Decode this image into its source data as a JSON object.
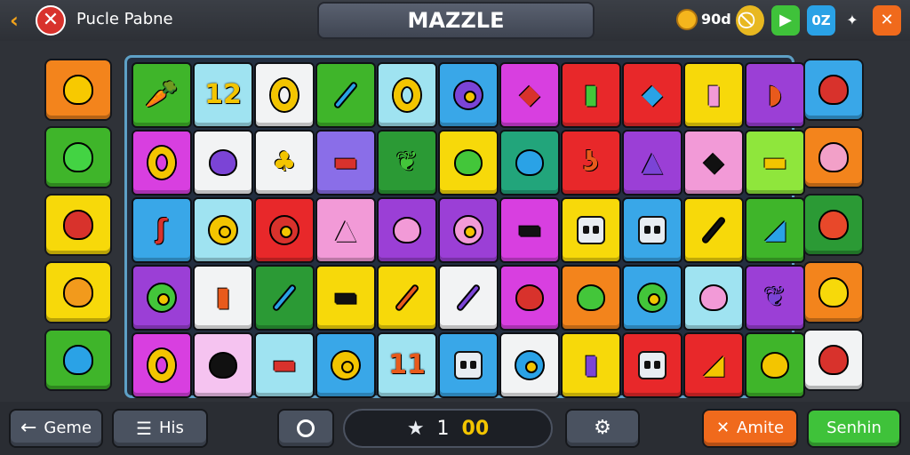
{
  "header": {
    "back_icon": "chevron-left-icon",
    "close_icon": "x-circle-icon",
    "puzzle_name": "Pucle Pabne",
    "title": "MAZZLE",
    "coin_icon": "coin-icon",
    "coin_count": "90d",
    "buttons": [
      {
        "name": "no-ads-icon",
        "label": "⃠"
      },
      {
        "name": "play-icon",
        "label": "▶"
      },
      {
        "name": "oz-badge",
        "label": "0Z"
      },
      {
        "name": "sparkle-icon",
        "label": "✦"
      },
      {
        "name": "close-icon",
        "label": "✕"
      }
    ]
  },
  "colors": {
    "orange": "#f3841c",
    "green": "#3fb52a",
    "yellow": "#f7d90a",
    "blue": "#39a7e8",
    "white": "#f2f3f4",
    "cyan": "#9fe3f1",
    "red": "#e8282a",
    "purple": "#9b3fd6",
    "magenta": "#d83fe0",
    "pink": "#f29ad7",
    "lime": "#8fe63c",
    "teal": "#22a57b",
    "darkgreen": "#2b9a35",
    "violet": "#8a6ee8",
    "lightpink": "#f5c3f0"
  },
  "left_column": [
    {
      "bg": "orange",
      "icon": "flower-icon",
      "color": "#f7c900"
    },
    {
      "bg": "green",
      "icon": "bomb-icon",
      "color": "#43d343"
    },
    {
      "bg": "yellow",
      "icon": "strawberry-icon",
      "color": "#d8322c"
    },
    {
      "bg": "yellow",
      "icon": "shield-icon",
      "color": "#f29a1c"
    },
    {
      "bg": "green",
      "icon": "compass-icon",
      "color": "#2aa2e6"
    }
  ],
  "right_column": [
    {
      "bg": "blue",
      "icon": "strawberry-icon",
      "color": "#d8322c"
    },
    {
      "bg": "orange",
      "icon": "candy-icon",
      "color": "#f2a0c8"
    },
    {
      "bg": "darkgreen",
      "icon": "flower-icon",
      "color": "#e8482a"
    },
    {
      "bg": "orange",
      "icon": "zero-icon",
      "color": "#f7d90a"
    },
    {
      "bg": "white",
      "icon": "strawberry-icon",
      "color": "#d8322c"
    }
  ],
  "grid": [
    [
      {
        "bg": "green",
        "icon": "carrot-icon",
        "glyph": "🥕"
      },
      {
        "bg": "cyan",
        "icon": "twelve-icon",
        "glyph": "12"
      },
      {
        "bg": "white",
        "icon": "zero-icon",
        "glyph": "0"
      },
      {
        "bg": "green",
        "icon": "feather-icon",
        "glyph": "/"
      },
      {
        "bg": "cyan",
        "icon": "zero-icon",
        "glyph": "0"
      },
      {
        "bg": "blue",
        "icon": "flower-icon",
        "glyph": "✿"
      },
      {
        "bg": "magenta",
        "icon": "lemon-icon",
        "glyph": "◆"
      },
      {
        "bg": "red",
        "icon": "card-icon",
        "glyph": "▮"
      },
      {
        "bg": "red",
        "icon": "bag-icon",
        "glyph": "◆"
      },
      {
        "bg": "yellow",
        "icon": "bottle-icon",
        "glyph": "▮"
      },
      {
        "bg": "purple",
        "icon": "shell-icon",
        "glyph": "◗"
      }
    ],
    [
      {
        "bg": "magenta",
        "icon": "zero-icon",
        "glyph": "0"
      },
      {
        "bg": "white",
        "icon": "lollipop-icon",
        "glyph": "●"
      },
      {
        "bg": "white",
        "icon": "drumstick-icon",
        "glyph": "♣"
      },
      {
        "bg": "violet",
        "icon": "battery-icon",
        "glyph": "▬"
      },
      {
        "bg": "darkgreen",
        "icon": "leaf-icon",
        "glyph": "❦"
      },
      {
        "bg": "yellow",
        "icon": "lemon-icon",
        "glyph": "●"
      },
      {
        "bg": "teal",
        "icon": "fruit-icon",
        "glyph": "●"
      },
      {
        "bg": "red",
        "icon": "hook-icon",
        "glyph": "ʖ"
      },
      {
        "bg": "purple",
        "icon": "bird-icon",
        "glyph": "▲"
      },
      {
        "bg": "pink",
        "icon": "gem-icon",
        "glyph": "◆"
      },
      {
        "bg": "lime",
        "icon": "tube-icon",
        "glyph": "▬"
      }
    ],
    [
      {
        "bg": "blue",
        "icon": "boomerang-icon",
        "glyph": "ʃ"
      },
      {
        "bg": "cyan",
        "icon": "gear-flower-icon",
        "glyph": "✺"
      },
      {
        "bg": "red",
        "icon": "daisy-icon",
        "glyph": "✿"
      },
      {
        "bg": "pink",
        "icon": "chili-icon",
        "glyph": "▲"
      },
      {
        "bg": "purple",
        "icon": "ring-icon",
        "glyph": "◎"
      },
      {
        "bg": "purple",
        "icon": "sunflower-icon",
        "glyph": "✹"
      },
      {
        "bg": "magenta",
        "icon": "pepper-icon",
        "glyph": "▬"
      },
      {
        "bg": "yellow",
        "icon": "dice-icon",
        "glyph": "dice"
      },
      {
        "bg": "blue",
        "icon": "dice-icon",
        "glyph": "dice"
      },
      {
        "bg": "yellow",
        "icon": "crayon-icon",
        "glyph": "/"
      },
      {
        "bg": "green",
        "icon": "banana-icon",
        "glyph": "◢"
      }
    ],
    [
      {
        "bg": "purple",
        "icon": "flower-icon",
        "glyph": "✿"
      },
      {
        "bg": "white",
        "icon": "book-icon",
        "glyph": "▮"
      },
      {
        "bg": "darkgreen",
        "icon": "hammer-icon",
        "glyph": "/"
      },
      {
        "bg": "yellow",
        "icon": "battery-icon",
        "glyph": "▬"
      },
      {
        "bg": "yellow",
        "icon": "pin-icon",
        "glyph": "/"
      },
      {
        "bg": "white",
        "icon": "pencil-icon",
        "glyph": "/"
      },
      {
        "bg": "magenta",
        "icon": "apple-icon",
        "glyph": "●"
      },
      {
        "bg": "orange",
        "icon": "tomato-icon",
        "glyph": "●"
      },
      {
        "bg": "blue",
        "icon": "flower-icon",
        "glyph": "✿"
      },
      {
        "bg": "cyan",
        "icon": "donut-icon",
        "glyph": "◎"
      },
      {
        "bg": "purple",
        "icon": "leaf-icon",
        "glyph": "❦"
      }
    ],
    [
      {
        "bg": "magenta",
        "icon": "zero-icon",
        "glyph": "0"
      },
      {
        "bg": "lightpink",
        "icon": "leaf-icon",
        "glyph": "●"
      },
      {
        "bg": "cyan",
        "icon": "pipe-icon",
        "glyph": "▬"
      },
      {
        "bg": "blue",
        "icon": "bouquet-icon",
        "glyph": "✿"
      },
      {
        "bg": "cyan",
        "icon": "eleven-icon",
        "glyph": "11"
      },
      {
        "bg": "blue",
        "icon": "dice-icon",
        "glyph": "dice"
      },
      {
        "bg": "white",
        "icon": "grapes-icon",
        "glyph": "✿"
      },
      {
        "bg": "yellow",
        "icon": "cube-icon",
        "glyph": "▮"
      },
      {
        "bg": "red",
        "icon": "dice-icon",
        "glyph": "dice"
      },
      {
        "bg": "red",
        "icon": "banana-icon",
        "glyph": "◢"
      },
      {
        "bg": "green",
        "icon": "balloon-icon",
        "glyph": "●"
      }
    ]
  ],
  "footer": {
    "game_label": "Geme",
    "his_label": "His",
    "score_star": "★",
    "score_value": "1",
    "moves_value": "00",
    "settings_icon": "gear-icon",
    "amite_label": "Amite",
    "senhin_label": "Senhin"
  }
}
